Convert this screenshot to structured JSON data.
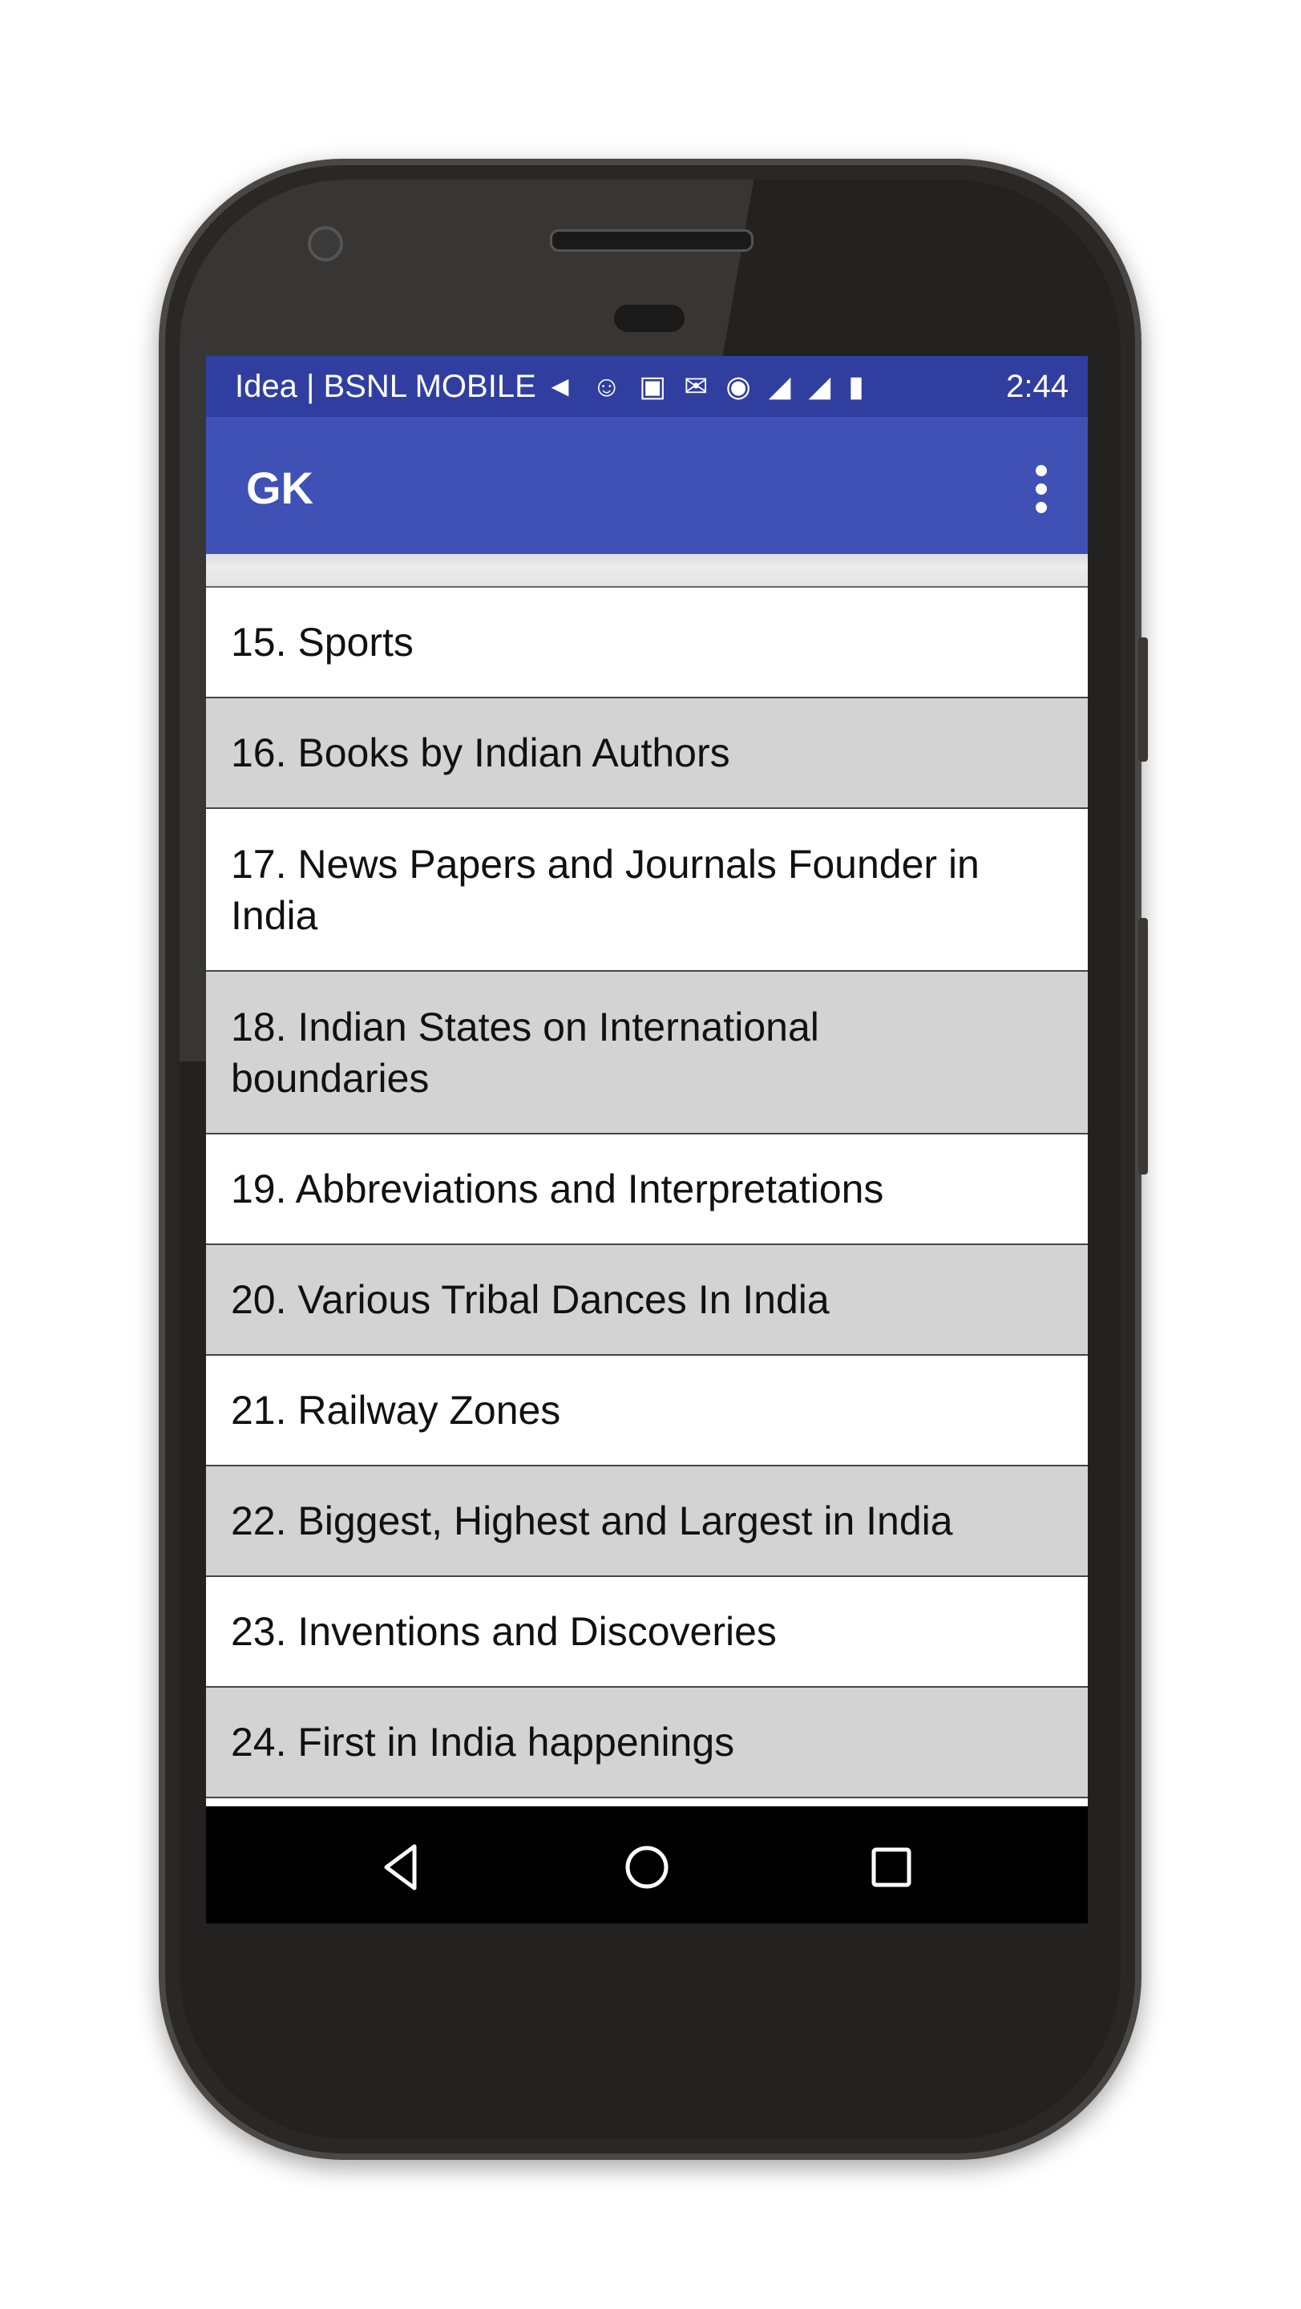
{
  "status_bar": {
    "carrier": "Idea | BSNL MOBILE",
    "time": "2:44",
    "icons": [
      "message-icon",
      "sms-icon",
      "image-icon",
      "gmail-icon",
      "location-icon",
      "signal-icon",
      "signal-icon",
      "battery-charging-icon"
    ]
  },
  "app_bar": {
    "title": "GK",
    "menu_icon": "more-vert-icon",
    "color": "#3f51b5",
    "status_color": "#303f9f"
  },
  "list": {
    "items": [
      {
        "label": "15. Sports"
      },
      {
        "label": "16. Books by Indian Authors"
      },
      {
        "label": "17. News Papers and Journals Founder in India"
      },
      {
        "label": "18. Indian States on International boundaries"
      },
      {
        "label": "19. Abbreviations and Interpretations"
      },
      {
        "label": "20. Various Tribal Dances In India"
      },
      {
        "label": "21. Railway Zones"
      },
      {
        "label": "22. Biggest, Highest and Largest in India"
      },
      {
        "label": "23. Inventions and Discoveries"
      },
      {
        "label": "24. First in India happenings"
      }
    ]
  },
  "nav_bar": {
    "icons": [
      "back-icon",
      "home-icon",
      "recents-icon"
    ]
  }
}
